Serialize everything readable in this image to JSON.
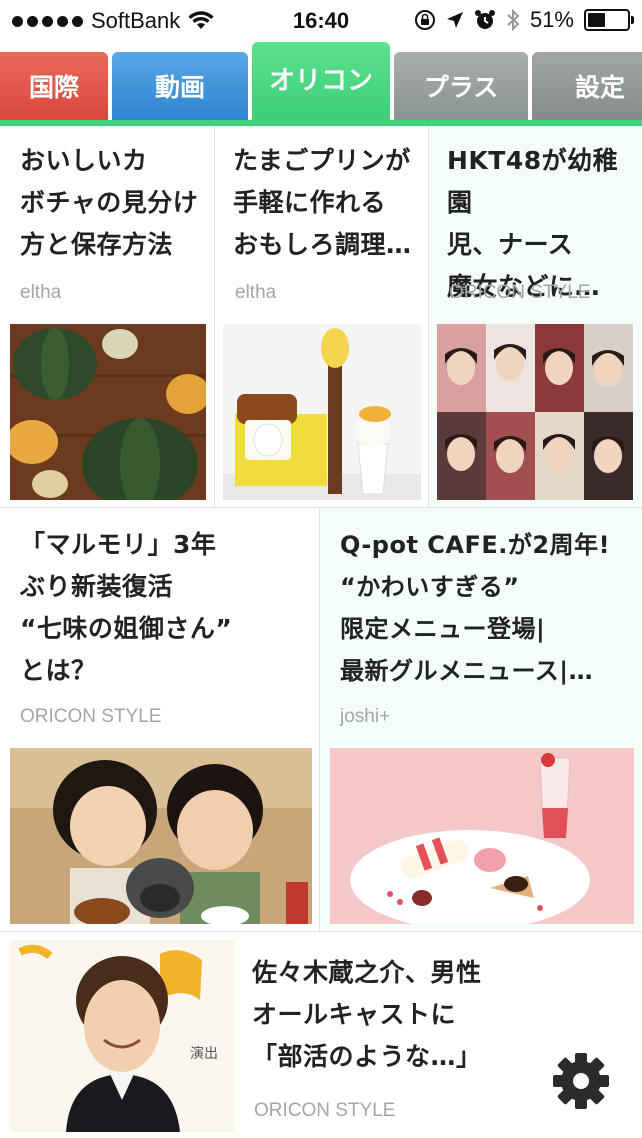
{
  "status_bar": {
    "carrier": "SoftBank",
    "time": "16:40",
    "battery_percent": "51%",
    "battery_level": 0.51,
    "icons": [
      "signal-dots",
      "wifi-icon",
      "rotation-lock-icon",
      "location-icon",
      "alarm-icon",
      "bluetooth-icon",
      "battery-icon"
    ]
  },
  "tabs": [
    {
      "label": "国際",
      "color": "#e05a4c"
    },
    {
      "label": "動画",
      "color": "#3d90d8"
    },
    {
      "label": "オリコン",
      "color": "#3fd37a",
      "active": true
    },
    {
      "label": "プラス",
      "color": "#959c9a"
    },
    {
      "label": "設定",
      "color": "#8d9492"
    }
  ],
  "articles": [
    {
      "title": "おいしいカ\nボチャの見分け\n方と保存方法",
      "source": "eltha",
      "image": "pumpkins-photo"
    },
    {
      "title": "たまごプリンが\n手軽に作れる\nおもしろ調理…",
      "source": "eltha",
      "image": "egg-pudding-maker-photo"
    },
    {
      "title": "HKT48が幼稚園\n児、ナース\n魔女などに…",
      "source": "ORICON STYLE",
      "image": "hkt48-collage-photo"
    },
    {
      "title": "「マルモリ」3年\nぶり新装復活\n“七味の姐御さん”\nとは？",
      "source": "ORICON STYLE",
      "image": "children-with-dog-photo"
    },
    {
      "title": "Q-pot CAFE.が2周年!\n“かわいすぎる”\n限定メニュー登場|\n最新グルメニュース|…",
      "source": "joshi+",
      "image": "cafe-dessert-photo"
    },
    {
      "title": "佐々木蔵之介、男性\nオールキャストに\n「部活のような…」",
      "source": "ORICON STYLE",
      "image": "actor-portrait-photo"
    }
  ],
  "accent_color": "#3fd37a",
  "settings_icon": "gear-icon"
}
